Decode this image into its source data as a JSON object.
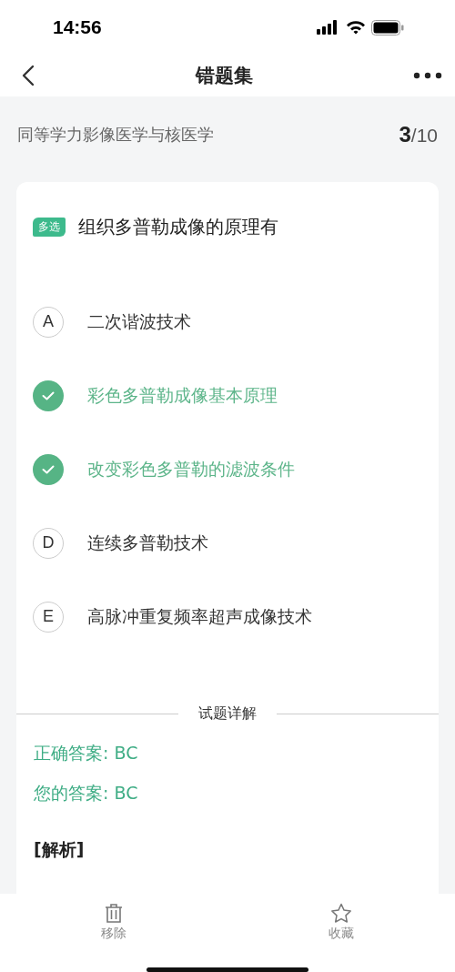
{
  "status_bar": {
    "time": "14:56"
  },
  "nav": {
    "title": "错题集"
  },
  "subject": {
    "name": "同等学力影像医学与核医学",
    "current": "3",
    "total": "/10"
  },
  "question": {
    "badge": "多选",
    "text": "组织多普勒成像的原理有",
    "options": [
      {
        "letter": "A",
        "text": "二次谐波技术",
        "selected": false
      },
      {
        "text": "彩色多普勒成像基本原理",
        "selected": true
      },
      {
        "text": "改变彩色多普勒的滤波条件",
        "selected": true
      },
      {
        "letter": "D",
        "text": "连续多普勒技术",
        "selected": false
      },
      {
        "letter": "E",
        "text": "高脉冲重复频率超声成像技术",
        "selected": false
      }
    ]
  },
  "explanation": {
    "heading": "试题详解",
    "correct_answer": "正确答案: BC",
    "your_answer": "您的答案: BC",
    "analysis_heading": "[解析]"
  },
  "bottom_bar": [
    {
      "kind": "remove",
      "label": "移除"
    },
    {
      "kind": "favorite",
      "label": "收藏"
    }
  ]
}
